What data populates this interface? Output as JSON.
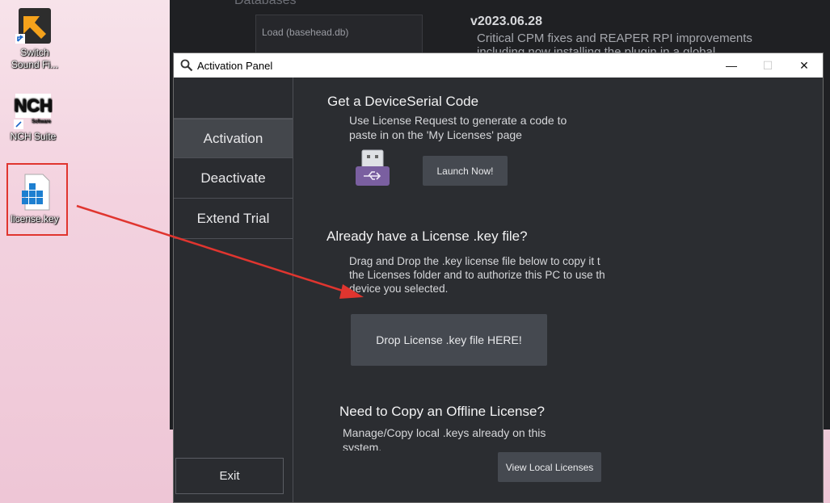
{
  "desktop": {
    "icons": [
      {
        "label_line1": "Switch",
        "label_line2": "Sound Fi..."
      },
      {
        "label": "NCH Suite"
      },
      {
        "label": "license.key"
      }
    ]
  },
  "background_app": {
    "db_header": "Databases",
    "db_item": "Load (basehead.db)",
    "version": "v2023.06.28",
    "line1": "Critical CPM fixes and REAPER RPI improvements",
    "line2": "including now installing the plugin in a global"
  },
  "window": {
    "title": "Activation Panel",
    "minimize": "—",
    "maximize": "☐",
    "close": "✕"
  },
  "sidebar": {
    "items": [
      {
        "label": "Activation",
        "active": true
      },
      {
        "label": "Deactivate",
        "active": false
      },
      {
        "label": "Extend Trial",
        "active": false
      }
    ],
    "exit_label": "Exit"
  },
  "main": {
    "serial_heading": "Get a DeviceSerial Code",
    "serial_text_1": "Use License Request to generate a code to",
    "serial_text_2": "paste in on the 'My Licenses' page",
    "launch_label": "Launch Now!",
    "license_heading": "Already have a License .key file?",
    "license_text_1": "Drag and Drop the .key license file below to copy it t",
    "license_text_2": "the Licenses folder and to authorize this PC to use th",
    "license_text_3": "device you selected.",
    "drop_label": "Drop License .key file HERE!",
    "offline_heading": "Need to Copy an Offline License?",
    "offline_text_1": "Manage/Copy local .keys already on this",
    "offline_text_2": "system.",
    "view_label": "View Local Licenses"
  },
  "colors": {
    "annotation": "#e0352f",
    "window_bg": "#2a2c30",
    "button_bg": "#454950"
  }
}
